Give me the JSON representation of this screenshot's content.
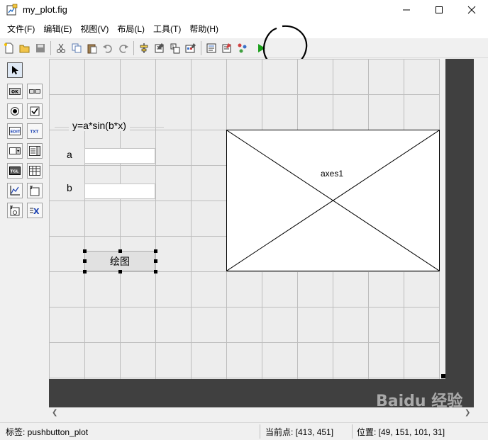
{
  "window": {
    "title": "my_plot.fig"
  },
  "menu": [
    "文件(F)",
    "编辑(E)",
    "视图(V)",
    "布局(L)",
    "工具(T)",
    "帮助(H)"
  ],
  "toolbar": {
    "icons": [
      "new-file-icon",
      "open-folder-icon",
      "save-icon",
      "cut-icon",
      "copy-icon",
      "paste-icon",
      "undo-icon",
      "redo-icon",
      "align-icon",
      "menu-editor-icon",
      "tab-order-icon",
      "toolbar-editor-icon",
      "editor-icon",
      "property-inspector-icon",
      "object-browser-icon",
      "run-icon"
    ]
  },
  "palette": [
    "select-icon",
    "pushbutton-icon",
    "slider-icon",
    "radiobutton-icon",
    "checkbox-icon",
    "edit-text-icon",
    "static-text-icon",
    "popup-menu-icon",
    "listbox-icon",
    "toggle-button-icon",
    "table-icon",
    "axes-icon",
    "panel-icon",
    "button-group-icon",
    "activex-icon"
  ],
  "figure": {
    "panel_title": "y=a*sin(b*x)",
    "label_a": "a",
    "label_b": "b",
    "edit_a_value": "",
    "edit_b_value": "",
    "button_label": "绘图",
    "axes_label": "axes1"
  },
  "status": {
    "tag": "标签: pushbutton_plot",
    "current_point": "当前点:  [413, 451]",
    "position": "位置: [49, 151, 101, 31]"
  },
  "watermark": "Baidu 经验",
  "colors": {
    "run_green": "#1a9e1a",
    "canvas_grid": "#bdbdbd",
    "dark_border": "#404040"
  }
}
